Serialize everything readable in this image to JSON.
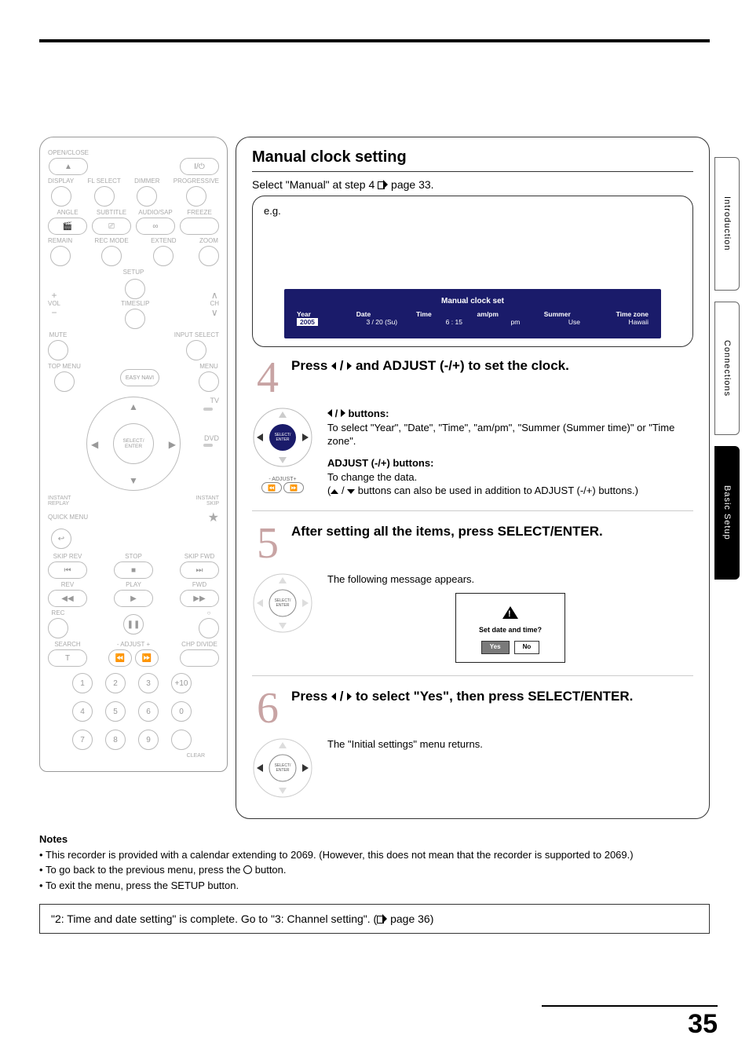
{
  "page_number": "35",
  "side_tabs": [
    "Introduction",
    "Connections",
    "Basic Setup"
  ],
  "remote": {
    "open_close": "OPEN/CLOSE",
    "power": "I/⏻",
    "row2": [
      "DISPLAY",
      "FL SELECT",
      "DIMMER",
      "PROGRESSIVE"
    ],
    "row3": [
      "ANGLE",
      "SUBTITLE",
      "AUDIO/SAP",
      "FREEZE"
    ],
    "row4": [
      "REMAIN",
      "REC MODE",
      "EXTEND",
      "ZOOM"
    ],
    "setup": "SETUP",
    "vol": "VOL",
    "timeslip": "TIMESLIP",
    "ch": "CH",
    "mute": "MUTE",
    "input_select": "INPUT SELECT",
    "top_menu": "TOP MENU",
    "easy_navi": "EASY\nNAVI",
    "menu": "MENU",
    "select_enter": "SELECT/\nENTER",
    "tv": "TV",
    "dvd": "DVD",
    "instant_replay": "INSTANT\nREPLAY",
    "instant_skip": "INSTANT\nSKIP",
    "quick_menu": "QUICK MENU",
    "skip_rev": "SKIP REV",
    "stop": "STOP",
    "skip_fwd": "SKIP FWD",
    "rev": "REV",
    "play": "PLAY",
    "fwd": "FWD",
    "rec": "REC",
    "search": "SEARCH",
    "adjust": "- ADJUST +",
    "chp_divide": "CHP DIVIDE",
    "clear": "CLEAR",
    "t": "T",
    "nums": [
      "1",
      "2",
      "3",
      "+10",
      "4",
      "5",
      "6",
      "0",
      "7",
      "8",
      "9"
    ]
  },
  "manual": {
    "title": "Manual clock setting",
    "select_line_pre": "Select \"Manual\" at step 4 ",
    "select_line_post": " page 33.",
    "eg": "e.g.",
    "osd_title": "Manual clock set",
    "osd_headers": [
      "Year",
      "Date",
      "Time",
      "am/pm",
      "Summer",
      "Time zone"
    ],
    "osd_values": [
      "2005",
      "3 / 20 (Su)",
      "6 : 15",
      "pm",
      "Use",
      "Hawaii"
    ],
    "step4": {
      "num": "4",
      "title_pre": "Press ",
      "title_mid": " and ADJUST (-/+) to set the clock.",
      "lr_buttons_label": " buttons:",
      "lr_desc": "To select \"Year\", \"Date\", \"Time\", \"am/pm\", \"Summer (Summer time)\" or \"Time zone\".",
      "adjust_label": "ADJUST (-/+) buttons:",
      "adjust_desc1": "To change the data.",
      "adjust_desc2_pre": "(",
      "adjust_desc2_post": " buttons can also be used in addition to ADJUST (-/+) buttons.)",
      "adjust_caption": "- ADJUST+"
    },
    "step5": {
      "num": "5",
      "title": "After setting all the items, press SELECT/ENTER.",
      "result": "The following message appears.",
      "dlg_text": "Set date and time?",
      "yes": "Yes",
      "no": "No",
      "select_enter": "SELECT/\nENTER"
    },
    "step6": {
      "num": "6",
      "title_pre": "Press ",
      "title_post": " to select \"Yes\", then press SELECT/ENTER.",
      "result": "The \"Initial settings\" menu returns.",
      "select_enter": "SELECT/\nENTER"
    }
  },
  "notes": {
    "heading": "Notes",
    "n1": "This recorder is provided with a calendar extending to 2069. (However, this does not mean that the recorder is supported to 2069.)",
    "n2_pre": "To go back to the previous menu, press the ",
    "n2_post": " button.",
    "n3": "To exit the menu, press the SETUP button."
  },
  "complete": {
    "text_pre": "\"2: Time and date setting\" is complete. Go to \"3: Channel setting\". (",
    "text_post": " page 36)"
  }
}
